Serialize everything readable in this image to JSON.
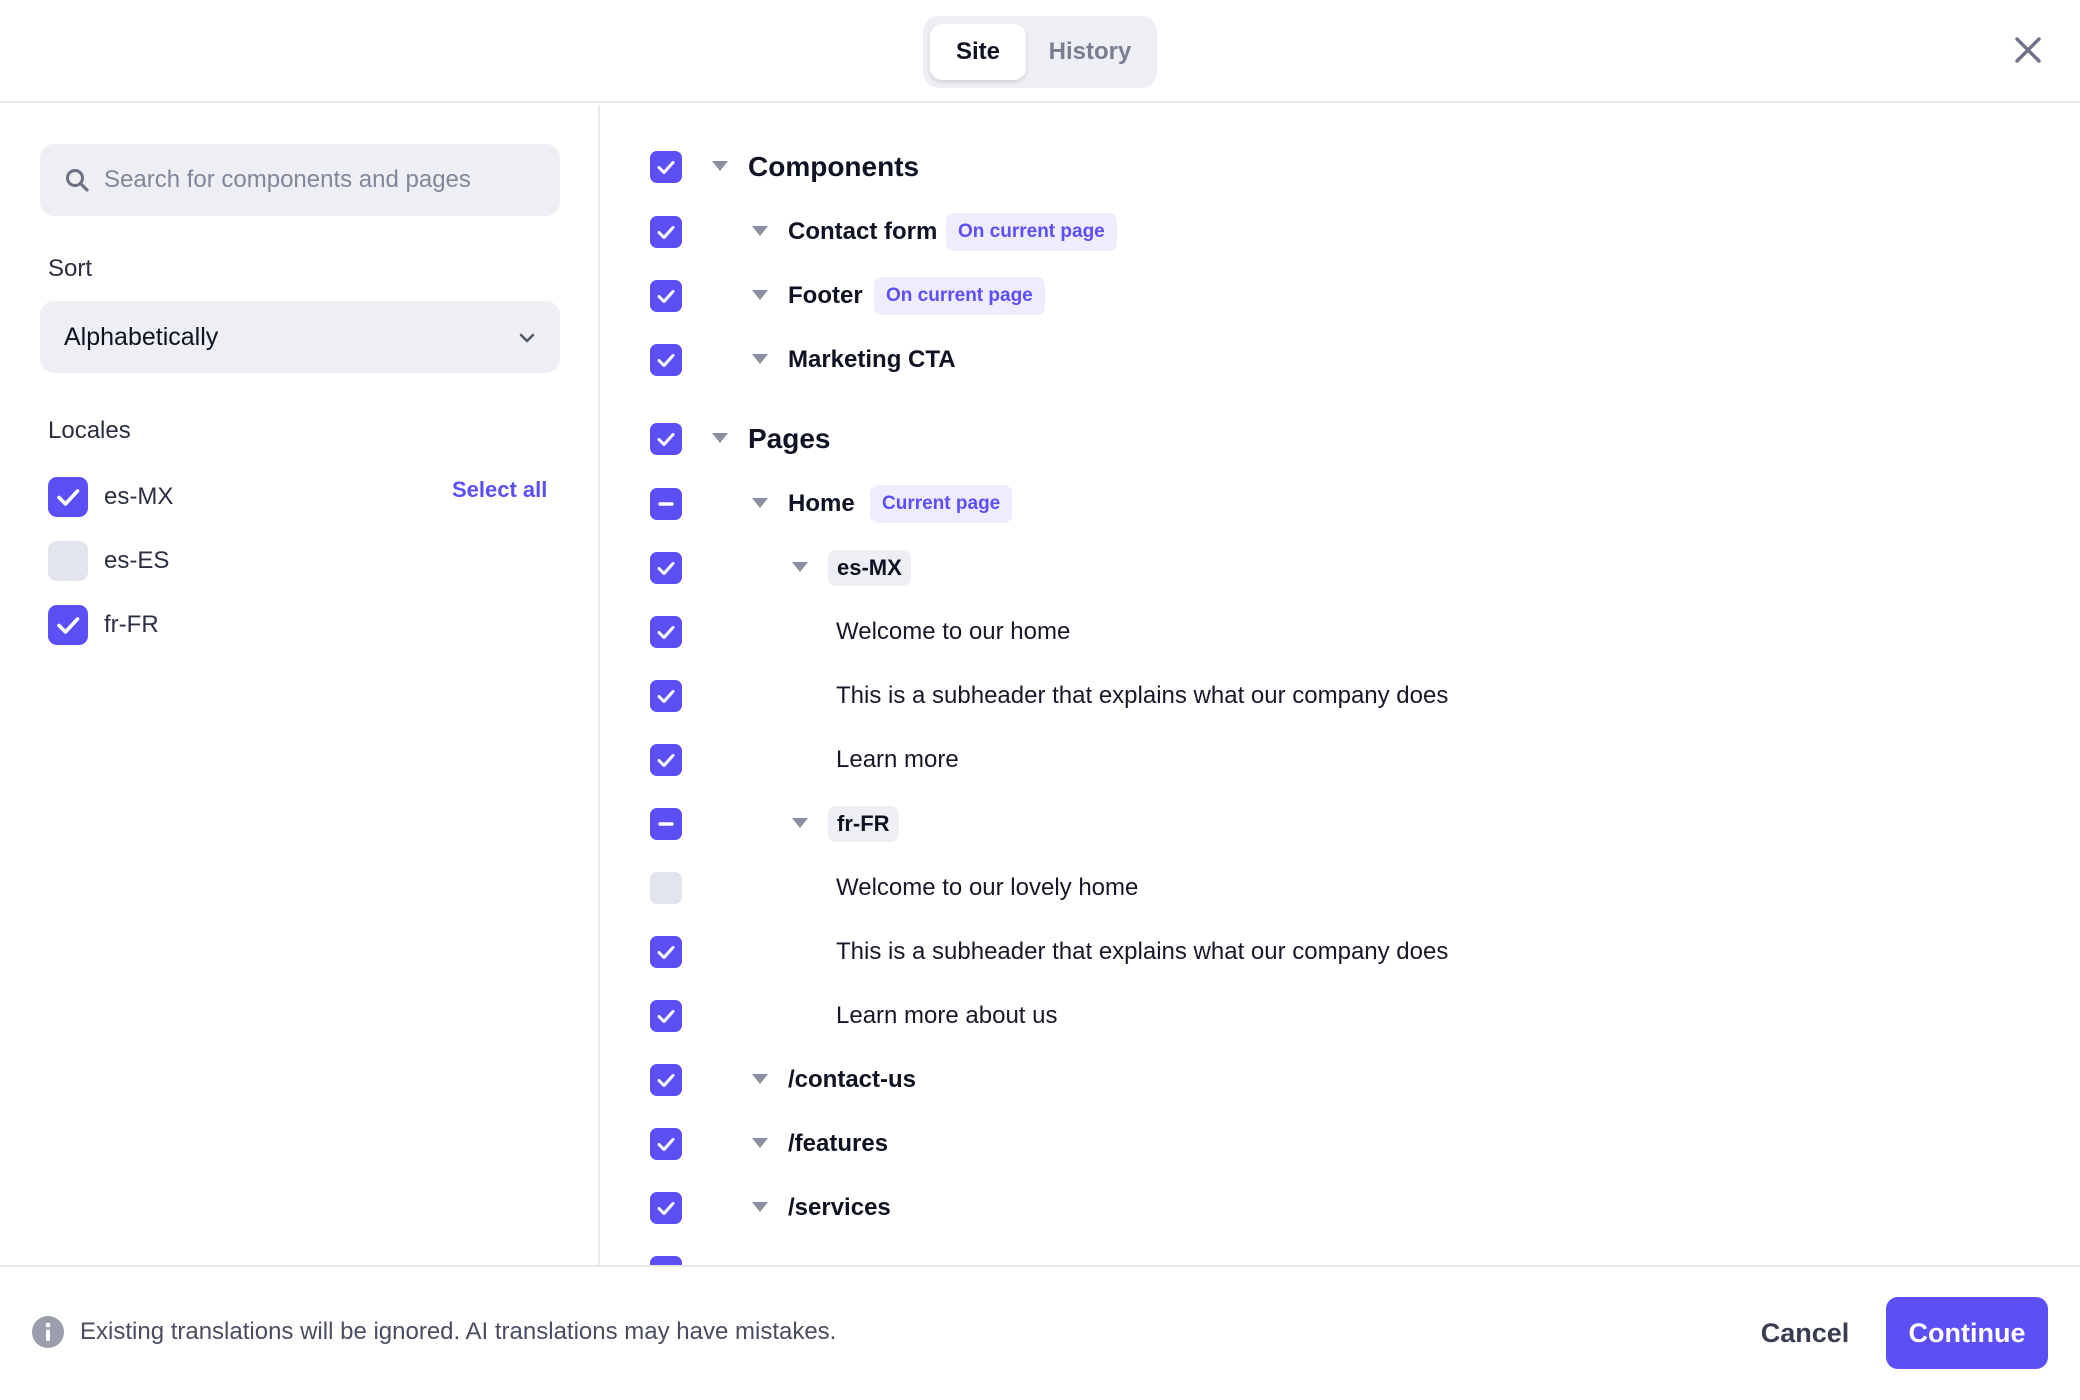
{
  "header": {
    "tabs": [
      {
        "label": "Site",
        "active": true
      },
      {
        "label": "History",
        "active": false
      }
    ],
    "close_icon": "close-icon"
  },
  "sidebar": {
    "search": {
      "placeholder": "Search for components and pages",
      "value": "",
      "icon": "search-icon"
    },
    "sort": {
      "label": "Sort",
      "value": "Alphabetically",
      "icon": "chevron-down-icon"
    },
    "locales": {
      "label": "Locales",
      "select_all": "Select all",
      "items": [
        {
          "code": "es-MX",
          "checked": true
        },
        {
          "code": "es-ES",
          "checked": false
        },
        {
          "code": "fr-FR",
          "checked": true
        }
      ]
    }
  },
  "tree": {
    "caret_icon": "caret-down-icon",
    "rows": [
      {
        "label": "Components",
        "kind": "section",
        "state": "checked"
      },
      {
        "label": "Contact form",
        "kind": "item",
        "state": "checked",
        "badge": "On current page"
      },
      {
        "label": "Footer",
        "kind": "item",
        "state": "checked",
        "badge": "On current page"
      },
      {
        "label": "Marketing CTA",
        "kind": "item",
        "state": "checked"
      },
      {
        "label": "Pages",
        "kind": "section",
        "state": "checked"
      },
      {
        "label": "Home",
        "kind": "item",
        "state": "partial",
        "badge": "Current page"
      },
      {
        "label": "es-MX",
        "kind": "locale",
        "state": "checked"
      },
      {
        "label": "Welcome to our home",
        "kind": "text",
        "state": "checked"
      },
      {
        "label": "This is a subheader that explains what our company does",
        "kind": "text",
        "state": "checked"
      },
      {
        "label": "Learn more",
        "kind": "text",
        "state": "checked"
      },
      {
        "label": "fr-FR",
        "kind": "locale",
        "state": "partial"
      },
      {
        "label": "Welcome to our lovely home",
        "kind": "text",
        "state": "unchecked"
      },
      {
        "label": "This is a subheader that explains what our company does",
        "kind": "text",
        "state": "checked"
      },
      {
        "label": "Learn more about us",
        "kind": "text",
        "state": "checked"
      },
      {
        "label": "/contact-us",
        "kind": "item",
        "state": "checked"
      },
      {
        "label": "/features",
        "kind": "item",
        "state": "checked"
      },
      {
        "label": "/services",
        "kind": "item",
        "state": "checked"
      }
    ]
  },
  "footer": {
    "info_icon": "info-icon",
    "note": "Existing translations will be ignored. AI translations may have mistakes.",
    "cancel_label": "Cancel",
    "continue_label": "Continue"
  },
  "colors": {
    "accent": "#5b4ff5",
    "badge_bg": "#eeecfe",
    "control_bg": "#eeeff4",
    "unchecked_bg": "#e3e5ec"
  }
}
